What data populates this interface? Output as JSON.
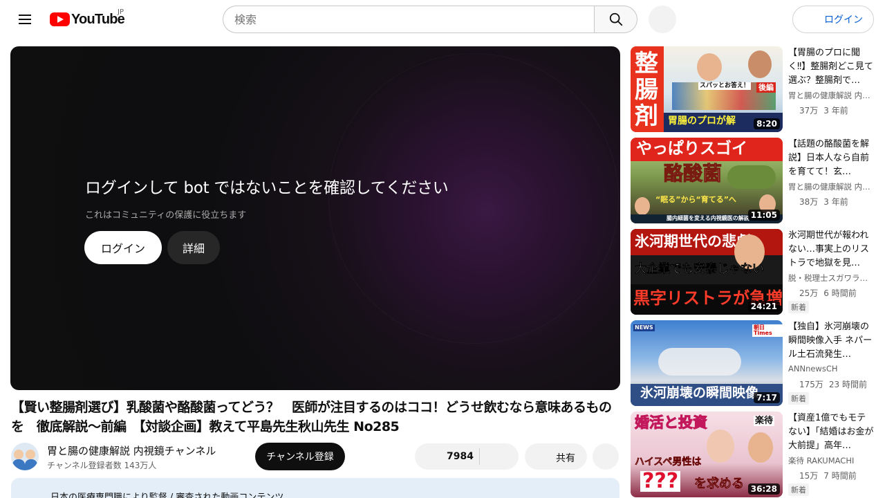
{
  "header": {
    "logo_text": "YouTube",
    "region": "JP",
    "search_placeholder": "検索",
    "login_label": "ログイン"
  },
  "player": {
    "title": "ログインして bot ではないことを確認してください",
    "subtitle": "これはコミュニティの保護に役立ちます",
    "login_label": "ログイン",
    "detail_label": "詳細"
  },
  "video": {
    "title": "【賢い整腸剤選び】乳酸菌や酪酸菌ってどう？　医師が注目するのはココ！どうせ飲むなら意味あるものを　徹底解説〜前編　【対談企画】教えて平島先生秋山先生 No285",
    "channel_name": "胃と腸の健康解説 内視鏡チャンネル",
    "subscribers": "チャンネル登録者数 143万人",
    "subscribe_label": "チャンネル登録",
    "like_count": "7984",
    "share_label": "共有",
    "info_text": "日本の医療専門職により監督 / 審査された動画コンテンツ"
  },
  "recommendations": [
    {
      "title": "【胃腸のプロに聞く‼】整腸剤どこ見て選ぶ？整腸剤で…",
      "channel": "胃と腸の健康解説 内…",
      "views": "37万",
      "age": "3 年前",
      "duration": "8:20",
      "badge": "",
      "thumb_text": [
        "整",
        "腸",
        "剤",
        "胃腸のプロが解",
        "後編",
        "スパッとお答え！"
      ]
    },
    {
      "title": "【話題の酪酸菌を解説】日本人なら自前を育てて！玄…",
      "channel": "胃と腸の健康解説 内…",
      "views": "38万",
      "age": "3 年前",
      "duration": "11:05",
      "badge": "",
      "thumb_text": [
        "やっぱりスゴイ",
        "酪酸菌",
        "“眠る”から“育てる”へ",
        "腸内細菌を変える内視鏡医の解説"
      ]
    },
    {
      "title": "氷河期世代が報われない…事実上のリストラで地獄を見…",
      "channel": "脱・税理士スガワラ…",
      "views": "25万",
      "age": "6 時間前",
      "duration": "24:21",
      "badge": "新着",
      "thumb_text": [
        "氷河期世代の悲劇",
        "大企業でも安泰じゃない",
        "黒字リストラが急増"
      ]
    },
    {
      "title": "【独自】氷河崩壊の瞬間映像入手 ネパール土石流発生…",
      "channel": "ANNnewsCH",
      "views": "175万",
      "age": "23 時間前",
      "duration": "7:17",
      "badge": "新着",
      "thumb_text": [
        "氷河崩壊の瞬間映像",
        "NEWS",
        "朝日Times"
      ]
    },
    {
      "title": "【資産1億でもモテない】「結婚はお金が大前提」高年…",
      "channel": "楽待 RAKUMACHI",
      "views": "15万",
      "age": "7 時間前",
      "duration": "36:28",
      "badge": "新着",
      "thumb_text": [
        "婚活と投資",
        "楽待",
        "ハイスペ男性は",
        "???",
        "を求める"
      ]
    }
  ],
  "colors": {
    "brand_red": "#ff0000",
    "link_blue": "#065fd4",
    "subscribe_bg": "#0f0f0f"
  }
}
